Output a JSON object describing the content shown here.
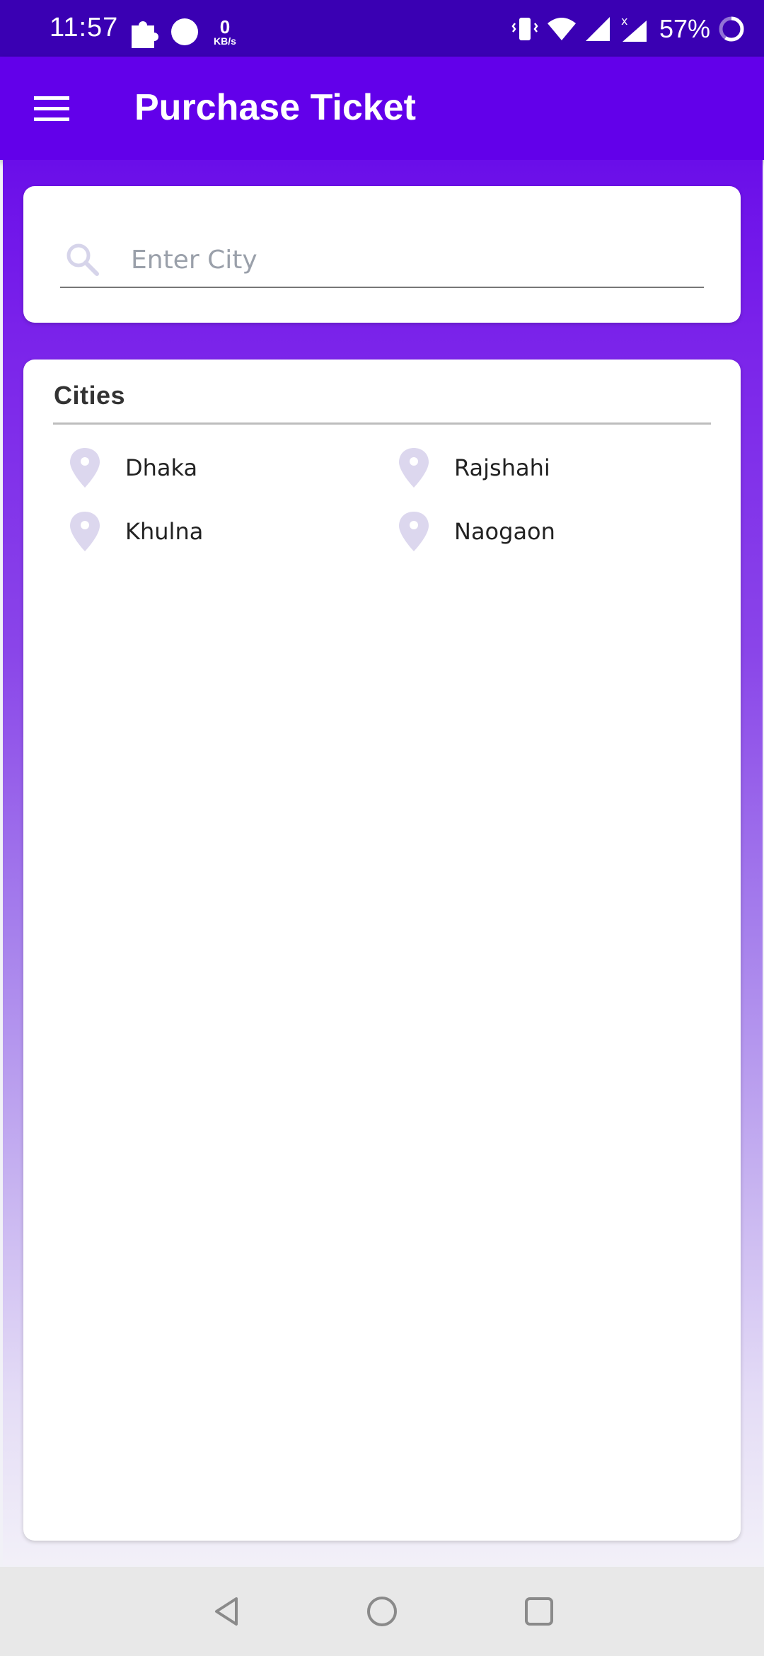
{
  "status_bar": {
    "time": "11:57",
    "data_speed_value": "0",
    "data_speed_unit": "KB/s",
    "battery": "57%"
  },
  "app_bar": {
    "title": "Purchase Ticket"
  },
  "search": {
    "placeholder": "Enter City",
    "value": ""
  },
  "cities": {
    "title": "Cities",
    "items": [
      {
        "name": "Dhaka"
      },
      {
        "name": "Rajshahi"
      },
      {
        "name": "Khulna"
      },
      {
        "name": "Naogaon"
      }
    ]
  },
  "colors": {
    "status_bar": "#3a00b3",
    "app_bar": "#6200ea",
    "pin": "#dcd7ee"
  },
  "icons": [
    "menu-icon",
    "search-icon",
    "location-pin-icon",
    "back-icon",
    "home-icon",
    "recents-icon"
  ]
}
